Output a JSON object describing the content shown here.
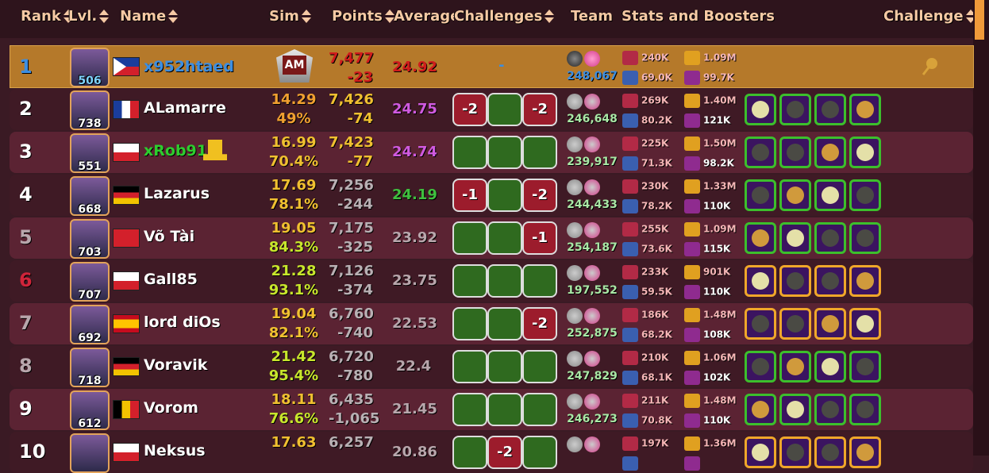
{
  "header": {
    "rank": "Rank",
    "lvl": "Lvl.",
    "name": "Name",
    "sim": "Sim",
    "points": "Points",
    "average": "Average",
    "challenges": "Challenges",
    "team": "Team",
    "stats": "Stats and Boosters",
    "challenge": "Challenge"
  },
  "self_row": {
    "rank": "1",
    "level": "506",
    "name": "x952htaed",
    "sim_badge": "AM",
    "points": "7,477",
    "points_diff": "-23",
    "average": "24.92",
    "challenges": "-",
    "team_value": "248,067",
    "stat_atk": "240K",
    "stat_def": "69.0K",
    "stat_ego": "1.09M",
    "stat_harm": "99.7K"
  },
  "rows": [
    {
      "rank": "2",
      "level": "738",
      "name": "ALamarre",
      "sim": "14.29",
      "sim_pct": "49%",
      "points": "7,426",
      "diff": "-74",
      "avg": "24.75",
      "ch": [
        "-2",
        "",
        "-2"
      ],
      "team": "246,648",
      "atk": "269K",
      "def": "80.2K",
      "ego": "1.40M",
      "harm": "121K"
    },
    {
      "rank": "3",
      "level": "551",
      "name": "xRob91",
      "sim": "16.99",
      "sim_pct": "70.4%",
      "points": "7,423",
      "diff": "-77",
      "avg": "24.74",
      "ch": [
        "",
        "",
        ""
      ],
      "team": "239,917",
      "atk": "225K",
      "def": "71.3K",
      "ego": "1.50M",
      "harm": "98.2K"
    },
    {
      "rank": "4",
      "level": "668",
      "name": "Lazarus",
      "sim": "17.69",
      "sim_pct": "78.1%",
      "points": "7,256",
      "diff": "-244",
      "avg": "24.19",
      "ch": [
        "-1",
        "",
        "-2"
      ],
      "team": "244,433",
      "atk": "230K",
      "def": "78.2K",
      "ego": "1.33M",
      "harm": "110K"
    },
    {
      "rank": "5",
      "level": "703",
      "name": "Võ Tài",
      "sim": "19.05",
      "sim_pct": "84.3%",
      "points": "7,175",
      "diff": "-325",
      "avg": "23.92",
      "ch": [
        "",
        "",
        "-1"
      ],
      "team": "254,187",
      "atk": "255K",
      "def": "73.6K",
      "ego": "1.09M",
      "harm": "115K"
    },
    {
      "rank": "6",
      "level": "707",
      "name": "Gall85",
      "sim": "21.28",
      "sim_pct": "93.1%",
      "points": "7,126",
      "diff": "-374",
      "avg": "23.75",
      "ch": [
        "",
        "",
        ""
      ],
      "team": "197,552",
      "atk": "233K",
      "def": "59.5K",
      "ego": "901K",
      "harm": "110K"
    },
    {
      "rank": "7",
      "level": "692",
      "name": "lord diOs",
      "sim": "19.04",
      "sim_pct": "82.1%",
      "points": "6,760",
      "diff": "-740",
      "avg": "22.53",
      "ch": [
        "",
        "",
        "-2"
      ],
      "team": "252,875",
      "atk": "186K",
      "def": "68.2K",
      "ego": "1.48M",
      "harm": "108K"
    },
    {
      "rank": "8",
      "level": "718",
      "name": "Voravik",
      "sim": "21.42",
      "sim_pct": "95.4%",
      "points": "6,720",
      "diff": "-780",
      "avg": "22.4",
      "ch": [
        "",
        "",
        ""
      ],
      "team": "247,829",
      "atk": "210K",
      "def": "68.1K",
      "ego": "1.06M",
      "harm": "102K"
    },
    {
      "rank": "9",
      "level": "612",
      "name": "Vorom",
      "sim": "18.11",
      "sim_pct": "76.6%",
      "points": "6,435",
      "diff": "-1,065",
      "avg": "21.45",
      "ch": [
        "",
        "",
        ""
      ],
      "team": "246,273",
      "atk": "211K",
      "def": "70.8K",
      "ego": "1.48M",
      "harm": "110K"
    },
    {
      "rank": "10",
      "level": "",
      "name": "Neksus",
      "sim": "17.63",
      "sim_pct": "",
      "points": "6,257",
      "diff": "",
      "avg": "20.86",
      "ch": [
        "",
        "-2",
        ""
      ],
      "team": "",
      "atk": "197K",
      "def": "",
      "ego": "1.36M",
      "harm": ""
    }
  ],
  "colors": {
    "self_bg": "#b5792a",
    "odd_bg": "#5b2333",
    "even_bg": "#3f1a25",
    "green_ch": "#2f6a1f",
    "red_ch": "#9c1c2c"
  }
}
